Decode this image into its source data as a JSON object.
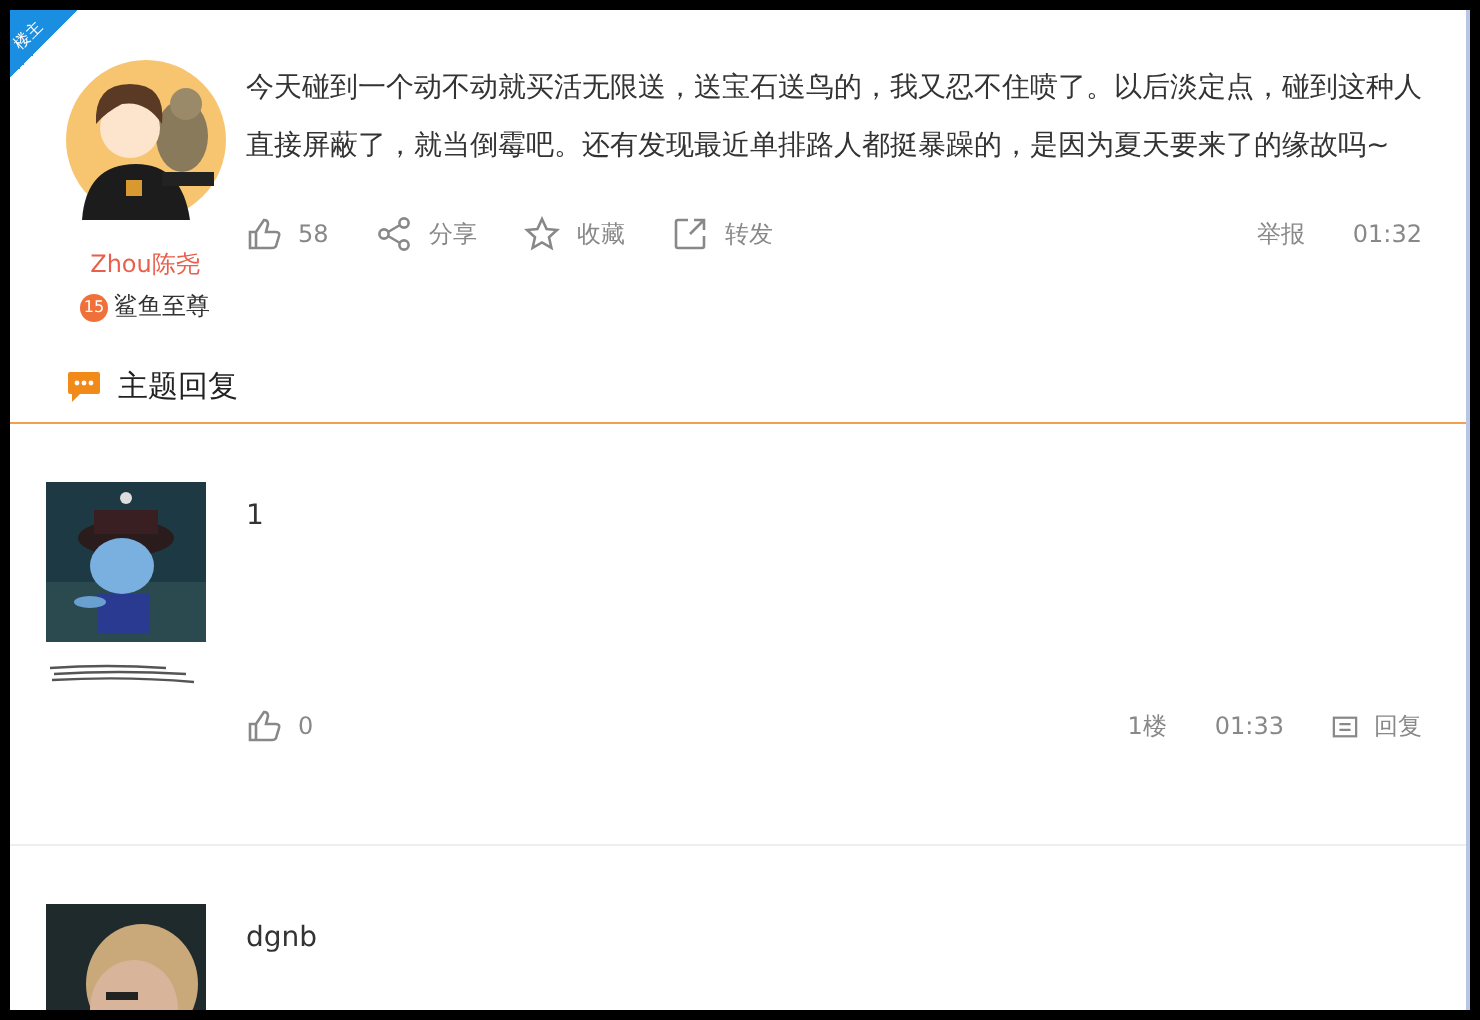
{
  "corner_badge": "楼主",
  "post": {
    "author": "Zhou陈尧",
    "level": "15",
    "rank": "鲨鱼至尊",
    "text": "今天碰到一个动不动就买活无限送，送宝石送鸟的，我又忍不住喷了。以后淡定点，碰到这种人直接屏蔽了，就当倒霉吧。还有发现最近单排路人都挺暴躁的，是因为夏天要来了的缘故吗~",
    "likes": "58",
    "actions": [
      "分享",
      "收藏",
      "转发"
    ],
    "report": "举报",
    "time": "01:32"
  },
  "replies_heading": "主题回复",
  "replies": [
    {
      "text": "1",
      "likes": "0",
      "floor": "1楼",
      "time": "01:33",
      "reply": "回复"
    },
    {
      "text": "dgnb"
    }
  ]
}
